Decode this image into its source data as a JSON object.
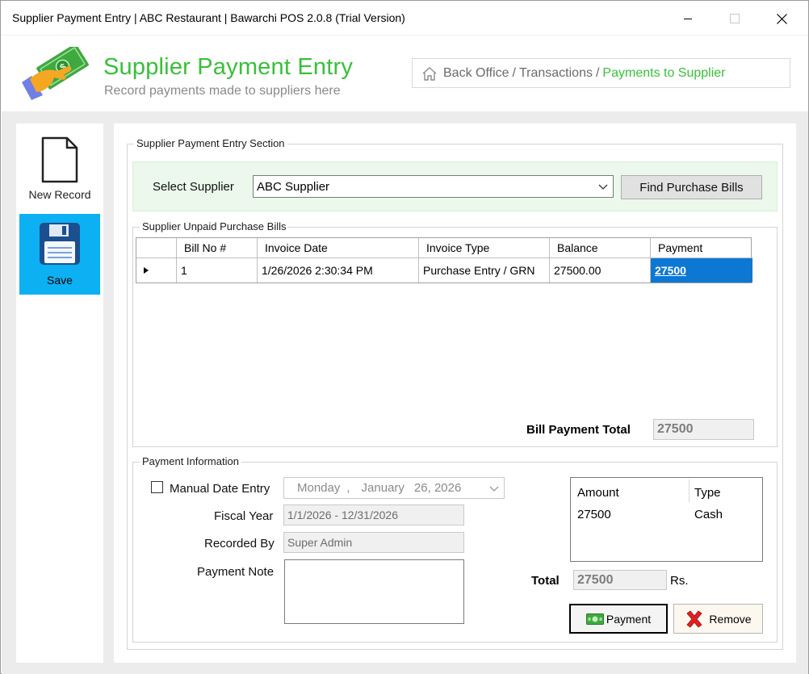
{
  "window": {
    "title": "Supplier Payment Entry | ABC Restaurant | Bawarchi POS 2.0.8 (Trial Version)"
  },
  "header": {
    "title": "Supplier Payment Entry",
    "subtitle": "Record payments made to suppliers here",
    "breadcrumb": [
      "Back Office",
      "Transactions",
      "Payments to Supplier"
    ]
  },
  "sidebar": {
    "new_record": "New Record",
    "save": "Save"
  },
  "entry_section": {
    "label": "Supplier Payment Entry Section",
    "select_supplier_label": "Select Supplier",
    "supplier_value": "ABC Supplier",
    "find_button": "Find Purchase Bills"
  },
  "bills_section": {
    "label": "Supplier Unpaid Purchase Bills",
    "columns": [
      "Bill No #",
      "Invoice Date",
      "Invoice Type",
      "Balance",
      "Payment"
    ],
    "rows": [
      {
        "bill_no": "1",
        "invoice_date": "1/26/2026 2:30:34 PM",
        "invoice_type": "Purchase Entry / GRN",
        "balance": "27500.00",
        "payment": "27500"
      }
    ],
    "total_label": "Bill Payment Total",
    "total_value": "27500"
  },
  "payment_info": {
    "label": "Payment Information",
    "manual_date_label": "Manual Date Entry",
    "manual_date_checked": false,
    "date_weekday": "Monday",
    "date_sep": ",",
    "date_month": "January",
    "date_day_year": "26, 2026",
    "fiscal_year_label": "Fiscal Year",
    "fiscal_year_value": "1/1/2026 - 12/31/2026",
    "recorded_by_label": "Recorded By",
    "recorded_by_value": "Super Admin",
    "payment_note_label": "Payment Note",
    "payment_note_value": "",
    "list_columns": [
      "Amount",
      "Type"
    ],
    "list_rows": [
      {
        "amount": "27500",
        "type": "Cash"
      }
    ],
    "total_label": "Total",
    "total_value": "27500",
    "currency": "Rs.",
    "payment_button": "Payment",
    "remove_button": "Remove"
  },
  "colors": {
    "accent_green": "#39c03a",
    "save_blue": "#0db0f3",
    "selection_blue": "#0d78d4",
    "remove_red": "#e02020"
  }
}
